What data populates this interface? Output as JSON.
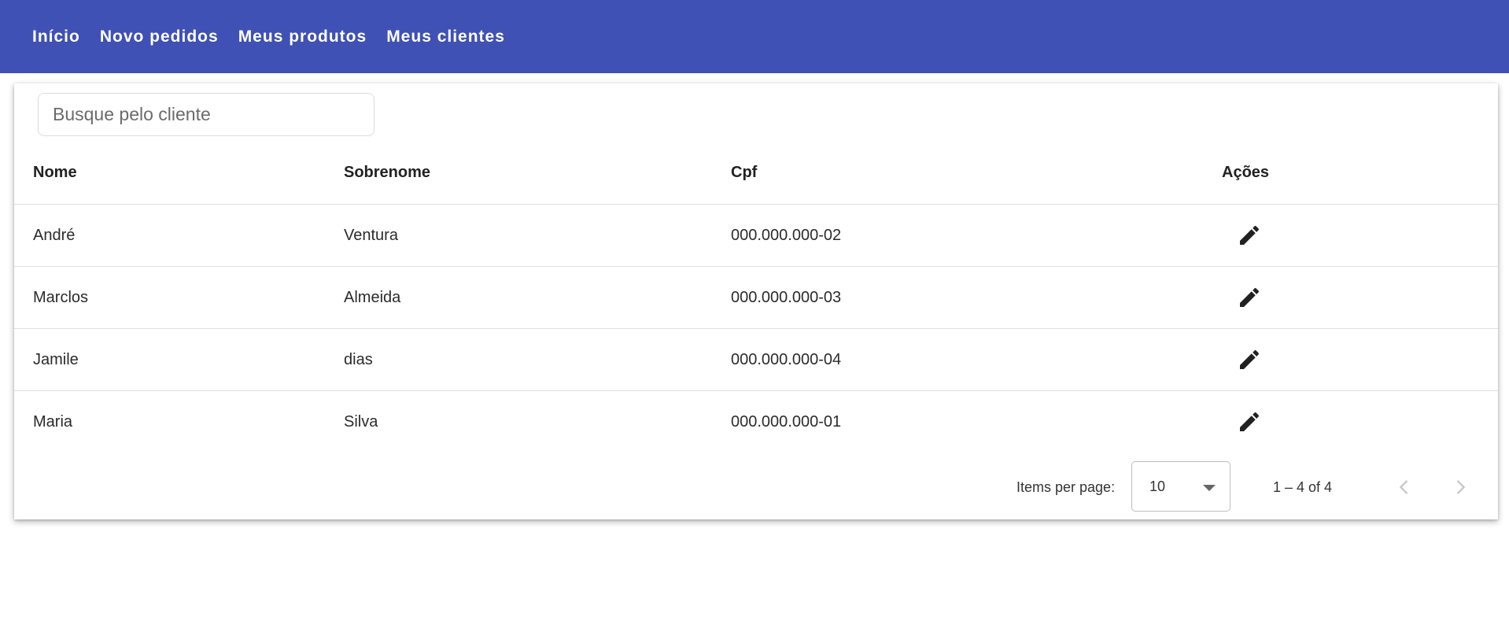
{
  "nav": {
    "items": [
      {
        "label": "Início"
      },
      {
        "label": "Novo pedidos"
      },
      {
        "label": "Meus produtos"
      },
      {
        "label": "Meus clientes"
      }
    ]
  },
  "search": {
    "placeholder": "Busque pelo cliente",
    "value": ""
  },
  "table": {
    "headers": {
      "nome": "Nome",
      "sobrenome": "Sobrenome",
      "cpf": "Cpf",
      "acoes": "Ações"
    },
    "rows": [
      {
        "nome": "André",
        "sobrenome": "Ventura",
        "cpf": "000.000.000-02",
        "action_icon": "edit-icon"
      },
      {
        "nome": "Marclos",
        "sobrenome": "Almeida",
        "cpf": "000.000.000-03",
        "action_icon": "edit-icon"
      },
      {
        "nome": "Jamile",
        "sobrenome": "dias",
        "cpf": "000.000.000-04",
        "action_icon": "edit-icon"
      },
      {
        "nome": "Maria",
        "sobrenome": "Silva",
        "cpf": "000.000.000-01",
        "action_icon": "edit-icon"
      }
    ]
  },
  "paginator": {
    "items_per_page_label": "Items per page:",
    "page_size": "10",
    "range_label": "1 – 4 of 4"
  },
  "colors": {
    "toolbar": "#3f51b5",
    "icon": "#212121",
    "arrow_disabled": "#c8c8c8"
  }
}
